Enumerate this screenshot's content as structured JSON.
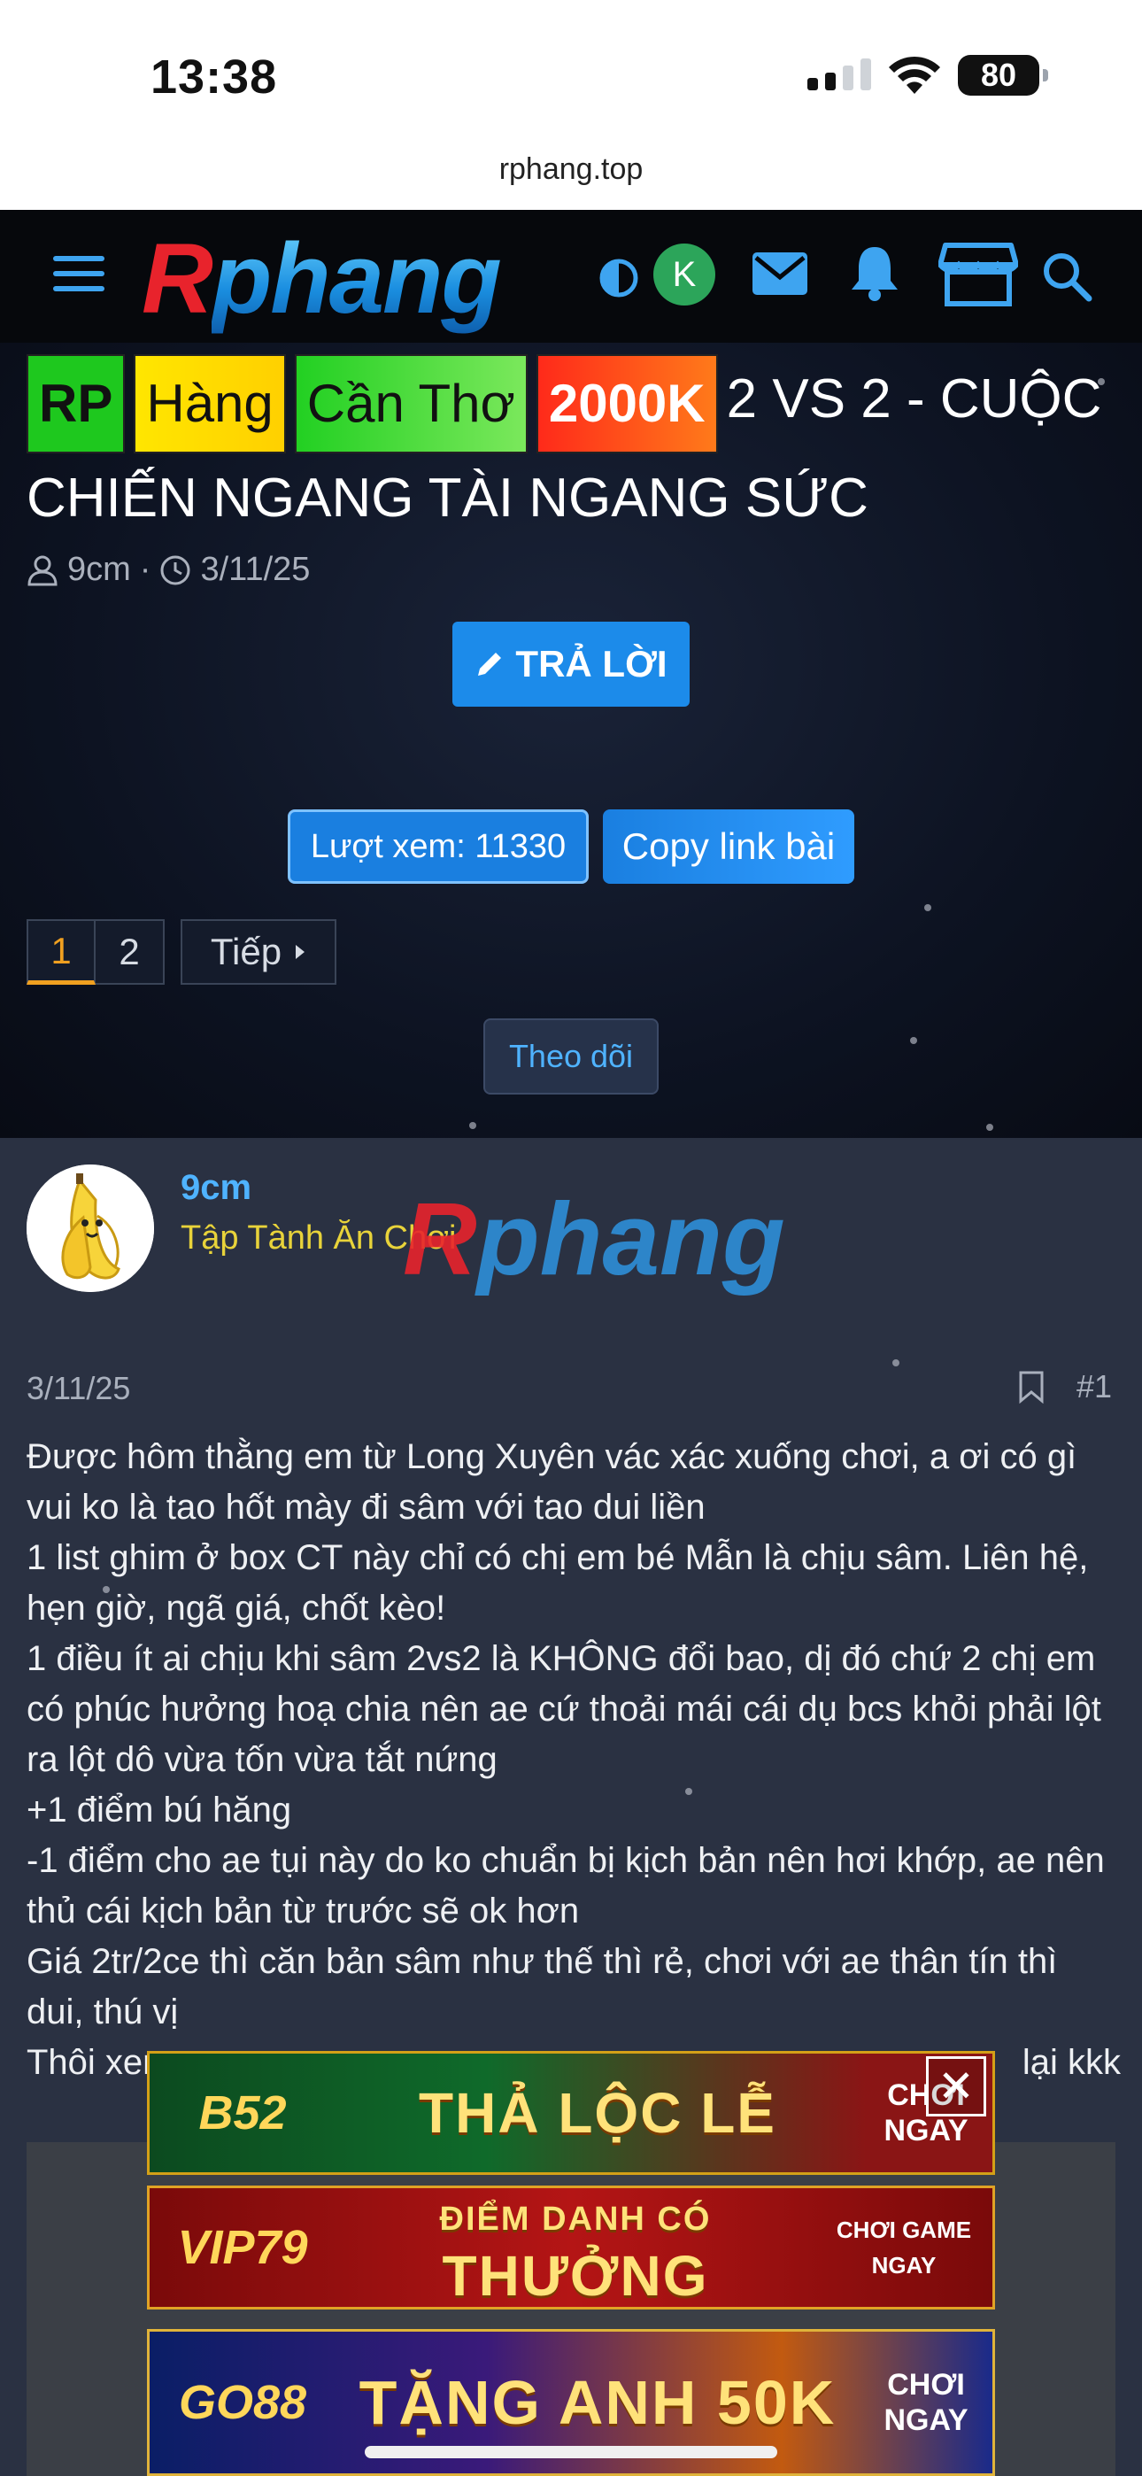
{
  "status_bar": {
    "time": "13:38",
    "battery": "80"
  },
  "browser": {
    "url": "rphang.top"
  },
  "header": {
    "logo_r": "R",
    "logo_rest": "phang",
    "avatar_letter": "K"
  },
  "thread": {
    "tags": [
      "RP",
      "Hàng",
      "Cần Thơ",
      "2000K"
    ],
    "title": "2 VS 2 - CUỘC CHIẾN NGANG TÀI NGANG SỨC",
    "author": "9cm",
    "date": "3/11/25",
    "reply_label": "TRẢ LỜI",
    "views_label": "Lượt xem: 11330",
    "copy_label": "Copy link bài",
    "pages": [
      "1",
      "2"
    ],
    "next_label": "Tiếp",
    "follow_label": "Theo dõi"
  },
  "post": {
    "username": "9cm",
    "user_title": "Tập Tành Ăn Chơi",
    "date": "3/11/25",
    "number": "#1",
    "lines": [
      "Được hôm thằng em từ Long Xuyên vác xác xuống chơi, a ơi có gì vui ko là tao hốt mày đi sâm với tao dui liền",
      "1 list ghim ở box CT này chỉ có chị em bé Mẫn là chịu sâm. Liên hệ, hẹn giờ, ngã giá, chốt kèo!",
      "1 điều ít ai chịu khi sâm 2vs2 là KHÔNG đổi bao, dị đó chứ 2 chị em có phúc hưởng hoạ chia nên ae cứ thoải mái cái dụ bcs khỏi phải lột ra lột dô vừa tốn vừa tắt nứng",
      "+1 điểm bú hăng",
      "-1 điểm cho ae tụi này do ko chuẩn bị kịch bản nên hơi khớp, ae nên thủ cái kịch bản từ trước sẽ ok hơn",
      "Giá 2tr/2ce thì căn bản sâm như thế thì rẻ, chơi với ae thân tín thì dui, thú vị",
      "Thôi xem"
    ],
    "last_line_tail": "lại kkk"
  },
  "ads": [
    {
      "brand": "B52",
      "text": "THẢ LỘC LỄ",
      "cta": [
        "CHƠI",
        "NGAY"
      ]
    },
    {
      "brand": "VIP79",
      "text_top": "ĐIỂM DANH CÓ",
      "text": "THƯỞNG",
      "cta": [
        "CHƠI GAME",
        "NGAY"
      ]
    },
    {
      "brand": "GO88",
      "text": "TẶNG ANH 50K",
      "cta": [
        "CHƠI",
        "NGAY"
      ]
    }
  ],
  "colors": {
    "accent": "#1c8bea",
    "header_bg": "#06080c",
    "post_bg": "#2a3142",
    "username": "#4fb3ff",
    "user_title": "#e8d33a",
    "active_page": "#f0a020"
  }
}
